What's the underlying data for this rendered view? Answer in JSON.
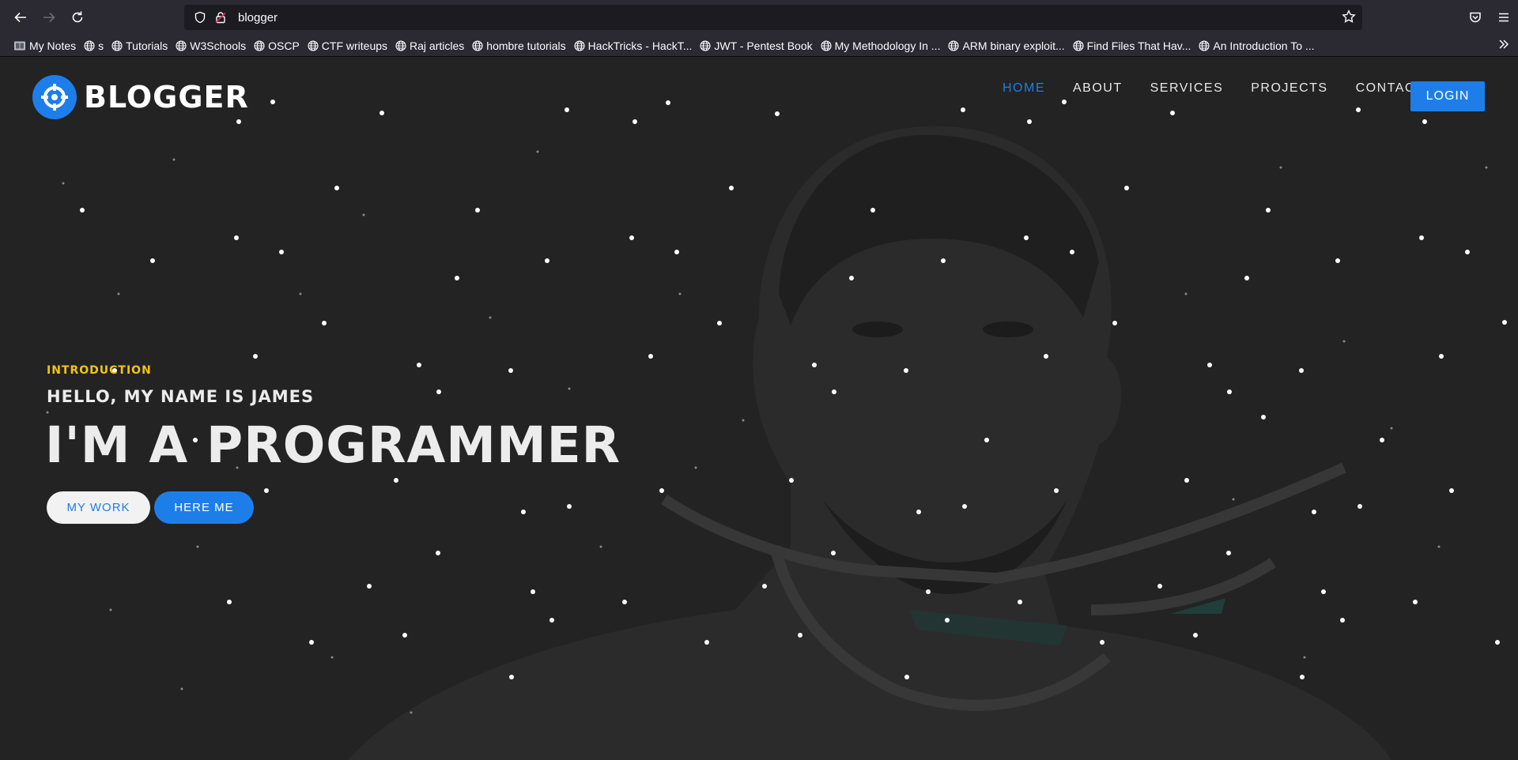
{
  "browser": {
    "url": "blogger",
    "bookmarks": [
      {
        "label": "My Notes",
        "icon": "notes-icon"
      },
      {
        "label": "s",
        "icon": "globe-icon"
      },
      {
        "label": "Tutorials",
        "icon": "globe-icon"
      },
      {
        "label": "W3Schools",
        "icon": "globe-icon"
      },
      {
        "label": "OSCP",
        "icon": "globe-icon"
      },
      {
        "label": "CTF writeups",
        "icon": "globe-icon"
      },
      {
        "label": "Raj articles",
        "icon": "globe-icon"
      },
      {
        "label": "hombre tutorials",
        "icon": "globe-icon"
      },
      {
        "label": "HackTricks - HackT...",
        "icon": "globe-icon"
      },
      {
        "label": "JWT - Pentest Book",
        "icon": "globe-icon"
      },
      {
        "label": "My Methodology In ...",
        "icon": "globe-icon"
      },
      {
        "label": "ARM binary exploit...",
        "icon": "globe-icon"
      },
      {
        "label": "Find Files That Hav...",
        "icon": "globe-icon"
      },
      {
        "label": "An Introduction To ...",
        "icon": "globe-icon"
      }
    ]
  },
  "site": {
    "brand": "BLOGGER",
    "nav": {
      "home": "HOME",
      "about": "ABOUT",
      "services": "SERVICES",
      "projects": "PROJECTS",
      "contact": "CONTACT",
      "login": "LOGIN"
    },
    "hero": {
      "intro": "INTRODUCTION",
      "hello": "HELLO, MY NAME IS JAMES",
      "headline": "I'M A PROGRAMMER",
      "btn_work": "MY WORK",
      "btn_here": "HERE ME"
    }
  },
  "colors": {
    "accent": "#1d7eea",
    "intro": "#f2c511",
    "page_bg": "#232323",
    "chrome_bg": "#2b2a33"
  }
}
